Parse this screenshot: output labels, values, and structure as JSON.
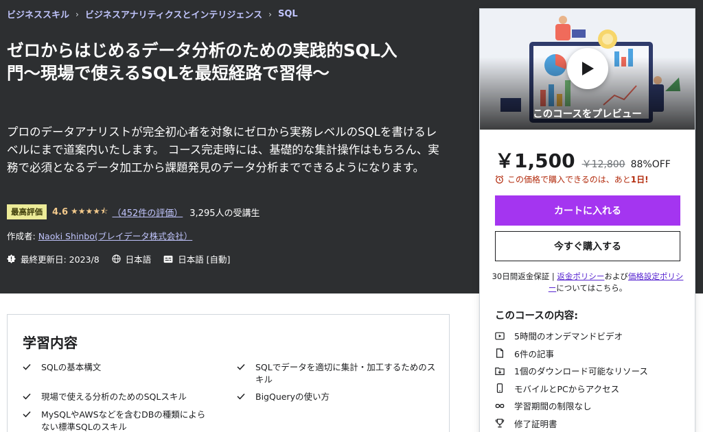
{
  "breadcrumb": [
    {
      "label": "ビジネススキル"
    },
    {
      "label": "ビジネスアナリティクスとインテリジェンス"
    },
    {
      "label": "SQL"
    }
  ],
  "course": {
    "title": "ゼロからはじめるデータ分析のための実践的SQL入門〜現場で使えるSQLを最短経路で習得〜",
    "subtitle": "プロのデータアナリストが完全初心者を対象にゼロから実務レベルのSQLを書けるレベルにまで道案内いたします。 コース完走時には、基礎的な集計操作はもちろん、実務で必須となるデータ加工から課題発見のデータ分析までできるようになります。",
    "badge": "最高評価",
    "rating": "4.6",
    "rating_stars": 4.6,
    "rating_count": "（452件の評価）",
    "students": "3,295人の受講生",
    "instructor_label": "作成者: ",
    "instructor_name": "Naoki Shinbo(ブレイデータ株式会社）",
    "last_updated": "最終更新日: 2023/8",
    "language": "日本語",
    "captions": "日本語 [自動]"
  },
  "purchase_card": {
    "preview_label": "このコースをプレビュー",
    "price": "￥1,500",
    "original_price": "￥12,800",
    "discount": "88%OFF",
    "timer_text": "この価格で購入できるのは、あと",
    "timer_days": "1日!",
    "add_to_cart": "カートに入れる",
    "buy_now": "今すぐ購入する",
    "guarantee_prefix": "30日間返金保証 | ",
    "refund_policy": "返金ポリシー",
    "and": "および",
    "pricing_policy": "価格設定ポリシー",
    "guarantee_suffix": "についてはこちら。",
    "includes_title": "このコースの内容:",
    "includes": [
      {
        "icon": "video-icon",
        "label": "5時間のオンデマンドビデオ"
      },
      {
        "icon": "article-icon",
        "label": "6件の記事"
      },
      {
        "icon": "download-folder-icon",
        "label": "1個のダウンロード可能なリソース"
      },
      {
        "icon": "mobile-icon",
        "label": "モバイルとPCからアクセス"
      },
      {
        "icon": "infinity-icon",
        "label": "学習期間の制限なし"
      },
      {
        "icon": "trophy-icon",
        "label": "修了証明書"
      }
    ]
  },
  "learn": {
    "title": "学習内容",
    "items": [
      "SQLの基本構文",
      "SQLでデータを適切に集計・加工するためのスキル",
      "現場で使える分析のためのSQLスキル",
      "BigQueryの使い方",
      "MySQLやAWSなどを含むDBの種類によらない標準SQLのスキル"
    ]
  },
  "colors": {
    "hero_bg": "#2d2f31",
    "accent_purple": "#a435f0",
    "link_lavender": "#c0c4fc",
    "star_gold": "#f3ca8c",
    "badge_yellow": "#eceb98",
    "timer_red": "#b32d0f"
  }
}
